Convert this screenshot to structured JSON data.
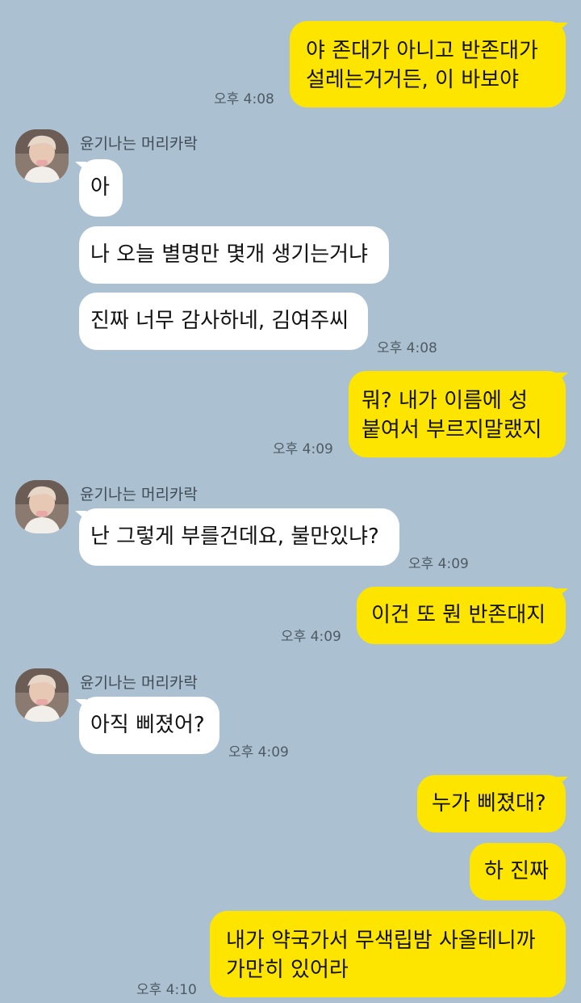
{
  "colors": {
    "background": "#abc1d1",
    "my_bubble": "#fee500",
    "their_bubble": "#ffffff",
    "meta_text": "#4f5a63"
  },
  "contact": {
    "name": "윤기나는 머리카락",
    "avatar_icon": "profile-photo-icon"
  },
  "messages": {
    "m1": {
      "lines": [
        "야 존대가 아니고 반존대가",
        "설레는거거든, 이 바보야"
      ],
      "time": "오후 4:08"
    },
    "g1_name": "윤기나는 머리카락",
    "m2": {
      "text": "아"
    },
    "m3": {
      "text": "나 오늘 별명만 몇개 생기는거냐"
    },
    "m4": {
      "text": "진짜 너무 감사하네, 김여주씨",
      "time": "오후 4:08"
    },
    "m5": {
      "lines": [
        "뭐? 내가 이름에 성",
        "붙여서 부르지말랬지"
      ],
      "time": "오후 4:09"
    },
    "g2_name": "윤기나는 머리카락",
    "m6": {
      "text": "난 그렇게 부를건데요, 불만있냐?",
      "time": "오후 4:09"
    },
    "m7": {
      "text": "이건 또 뭔 반존대지",
      "time": "오후 4:09"
    },
    "g3_name": "윤기나는 머리카락",
    "m8": {
      "text": "아직 삐졌어?",
      "time": "오후 4:09"
    },
    "m9": {
      "text": "누가 삐졌대?"
    },
    "m10": {
      "text": "하 진짜"
    },
    "m11": {
      "lines": [
        "내가 약국가서 무색립밤 사올테니까",
        "가만히 있어라"
      ],
      "time": "오후 4:10"
    }
  }
}
